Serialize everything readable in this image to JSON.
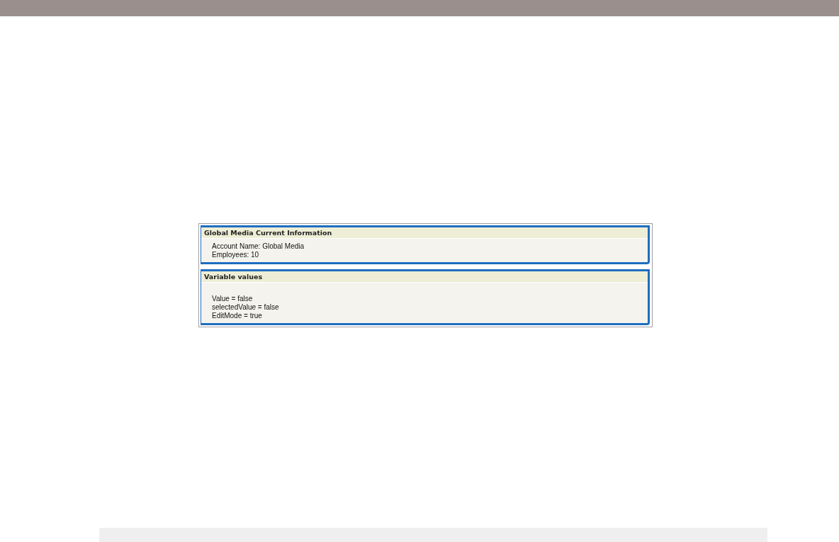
{
  "panels": [
    {
      "title": "Global Media Current Information",
      "lines": [
        "Account Name: Global Media",
        "Employees: 10"
      ]
    },
    {
      "title": "Variable values",
      "lines": [
        "Value = false",
        "selectedValue = false",
        "EditMode = true"
      ]
    }
  ]
}
